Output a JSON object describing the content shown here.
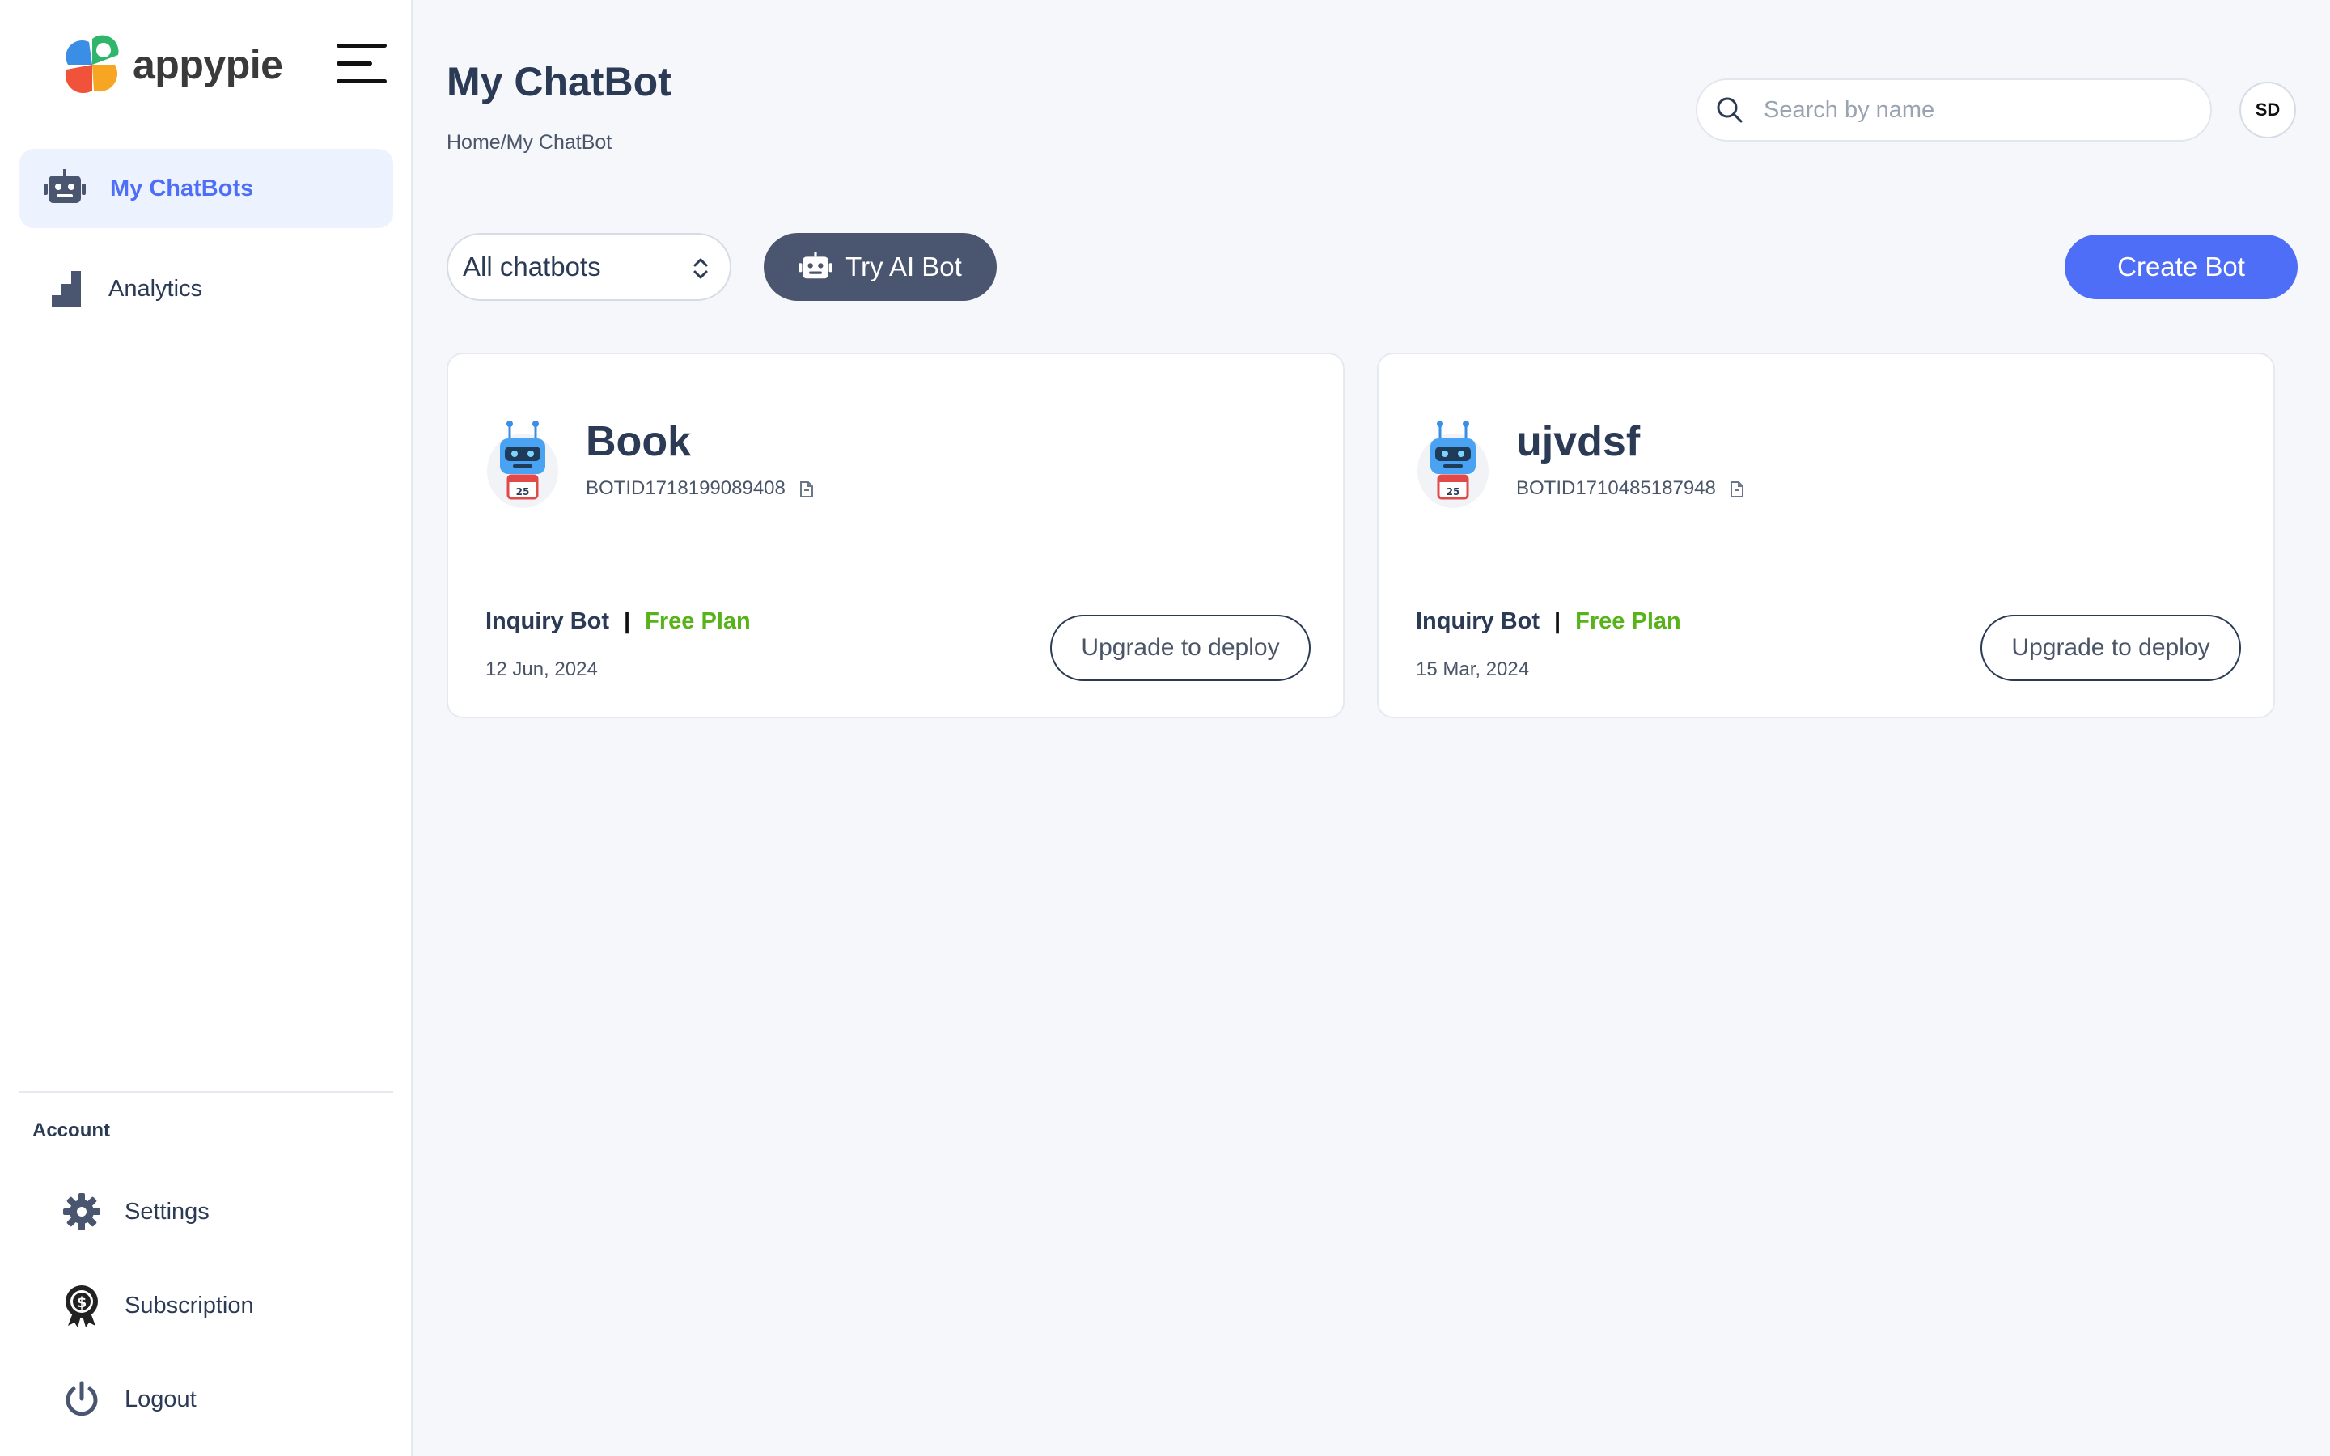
{
  "brand": {
    "name": "appypie"
  },
  "sidebar": {
    "items": [
      {
        "label": "My ChatBots",
        "icon": "robot-icon",
        "active": true
      },
      {
        "label": "Analytics",
        "icon": "analytics-icon",
        "active": false
      }
    ],
    "account_heading": "Account",
    "account_items": [
      {
        "label": "Settings",
        "icon": "gear-icon"
      },
      {
        "label": "Subscription",
        "icon": "badge-icon"
      },
      {
        "label": "Logout",
        "icon": "power-icon"
      }
    ]
  },
  "header": {
    "title": "My ChatBot",
    "breadcrumb": {
      "home": "Home",
      "separator": "/",
      "current": "My ChatBot"
    },
    "search_placeholder": "Search by name",
    "avatar_initials": "SD"
  },
  "toolbar": {
    "filter_value": "All chatbots",
    "try_ai_label": "Try AI Bot",
    "create_label": "Create Bot"
  },
  "bots": [
    {
      "name": "Book",
      "id": "BOTID1718199089408",
      "type": "Inquiry Bot",
      "separator": "|",
      "plan": "Free Plan",
      "date": "12 Jun, 2024",
      "action": "Upgrade to deploy"
    },
    {
      "name": "ujvdsf",
      "id": "BOTID1710485187948",
      "type": "Inquiry Bot",
      "separator": "|",
      "plan": "Free Plan",
      "date": "15 Mar, 2024",
      "action": "Upgrade to deploy"
    }
  ],
  "colors": {
    "accent": "#4f6ef7",
    "dark_button": "#4a5670",
    "plan_green": "#58b31b",
    "active_bg": "#edf3fe"
  }
}
